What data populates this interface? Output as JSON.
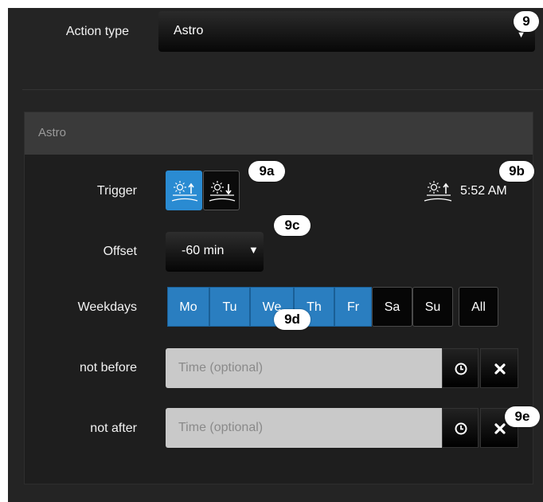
{
  "action_type": {
    "label": "Action type",
    "value": "Astro"
  },
  "section": {
    "title": "Astro"
  },
  "trigger": {
    "label": "Trigger",
    "options": [
      "sunrise",
      "sunset"
    ],
    "selected": "sunrise",
    "time_display": "5:52 AM"
  },
  "offset": {
    "label": "Offset",
    "value": "-60 min",
    "caret": "▼"
  },
  "weekdays": {
    "label": "Weekdays",
    "days": [
      {
        "label": "Mo",
        "selected": true
      },
      {
        "label": "Tu",
        "selected": true
      },
      {
        "label": "We",
        "selected": true
      },
      {
        "label": "Th",
        "selected": true
      },
      {
        "label": "Fr",
        "selected": true
      },
      {
        "label": "Sa",
        "selected": false
      },
      {
        "label": "Su",
        "selected": false
      }
    ],
    "all_label": "All"
  },
  "not_before": {
    "label": "not before",
    "placeholder": "Time (optional)"
  },
  "not_after": {
    "label": "not after",
    "placeholder": "Time (optional)"
  },
  "callouts": {
    "c9": "9",
    "c9a": "9a",
    "c9b": "9b",
    "c9c": "9c",
    "c9d": "9d",
    "c9e": "9e"
  },
  "colors": {
    "accent": "#2a8bd2",
    "background": "#242424"
  }
}
